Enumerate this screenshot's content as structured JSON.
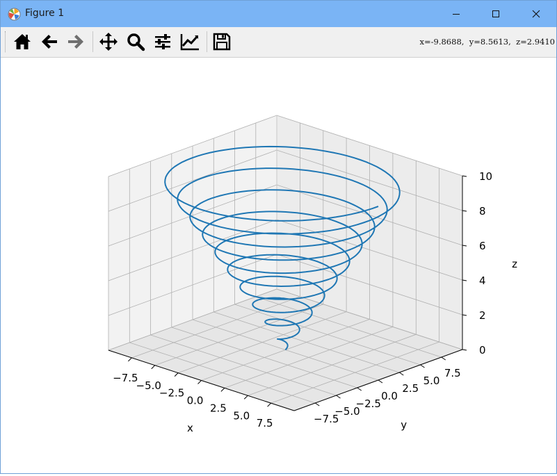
{
  "window": {
    "title": "Figure 1",
    "app_icon": "matplotlib-logo-icon",
    "controls": [
      "minimize-icon",
      "maximize-icon",
      "close-icon"
    ]
  },
  "toolbar": {
    "buttons": [
      {
        "name": "home-icon",
        "enabled": true
      },
      {
        "name": "back-arrow-icon",
        "enabled": true
      },
      {
        "name": "forward-arrow-icon",
        "enabled": false
      },
      {
        "name": "pan-move-icon",
        "enabled": true
      },
      {
        "name": "zoom-magnifier-icon",
        "enabled": true
      },
      {
        "name": "configure-subplots-icon",
        "enabled": true
      },
      {
        "name": "edit-axis-icon",
        "enabled": true
      },
      {
        "name": "save-floppy-icon",
        "enabled": true
      }
    ],
    "coords_text": "x=-9.8688,  y=8.5613,  z=2.9410"
  },
  "chart_data": {
    "type": "line",
    "projection": "3d",
    "title": "",
    "xlabel": "x",
    "ylabel": "y",
    "zlabel": "z",
    "xlim": [
      -10,
      10
    ],
    "ylim": [
      -10,
      10
    ],
    "zlim": [
      0,
      10
    ],
    "xticks": [
      "−7.5",
      "−5.0",
      "−2.5",
      "0.0",
      "2.5",
      "5.0",
      "7.5"
    ],
    "yticks": [
      "−7.5",
      "−5.0",
      "−2.5",
      "0.0",
      "2.5",
      "5.0",
      "7.5"
    ],
    "zticks": [
      "0",
      "2",
      "4",
      "6",
      "8",
      "10"
    ],
    "grid": true,
    "series": [
      {
        "color": "#1f77b4",
        "parametric": "x = t·cos(2πt), y = t·sin(2πt), z = t",
        "t_range": [
          0,
          10
        ],
        "description": "conical spiral (helix with linearly growing radius), 10 turns"
      }
    ]
  }
}
